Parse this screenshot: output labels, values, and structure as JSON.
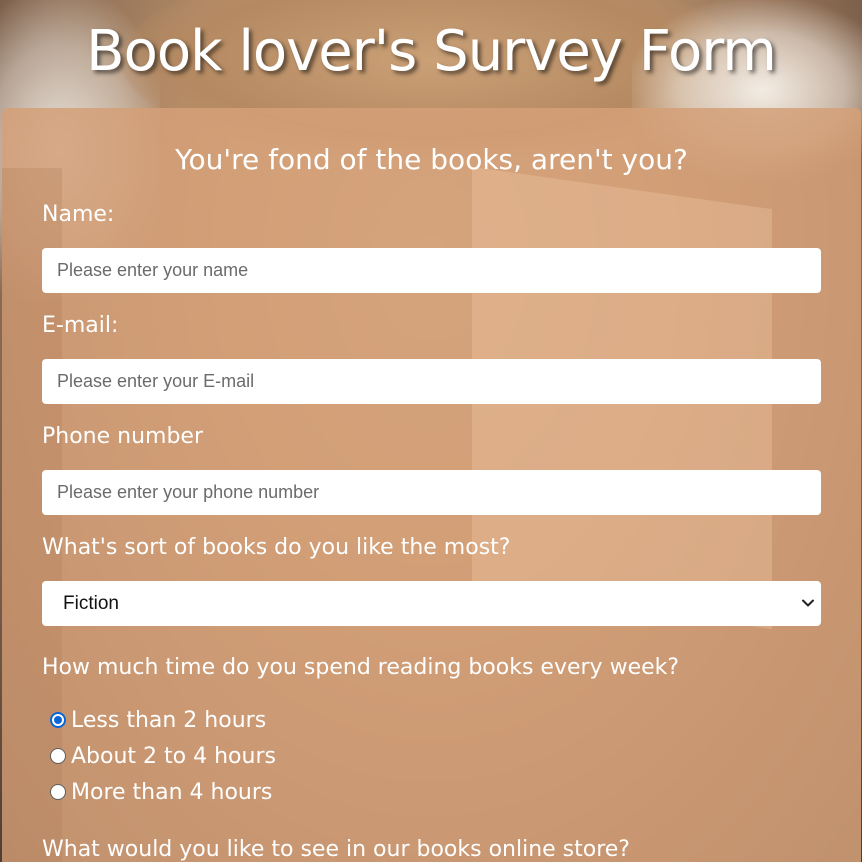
{
  "header": {
    "title": "Book lover's Survey Form"
  },
  "form": {
    "subtitle": "You're fond of the books, aren't you?",
    "name": {
      "label": "Name:",
      "placeholder": "Please enter your name",
      "value": ""
    },
    "email": {
      "label": "E-mail:",
      "placeholder": "Please enter your E-mail",
      "value": ""
    },
    "phone": {
      "label": "Phone number",
      "placeholder": "Please enter your phone number",
      "value": ""
    },
    "book_type": {
      "label": "What's sort of books do you like the most?",
      "selected": "Fiction"
    },
    "reading_time": {
      "label": "How much time do you spend reading books every week?",
      "options": [
        {
          "label": "Less than 2 hours",
          "checked": true
        },
        {
          "label": "About 2 to 4 hours",
          "checked": false
        },
        {
          "label": "More than 4 hours",
          "checked": false
        }
      ]
    },
    "store_question": {
      "label": "What would you like to see in our books online store?"
    }
  },
  "colors": {
    "card_background": "#d4a078",
    "radio_accent": "#0a65d8",
    "text": "#ffffff"
  },
  "icons": {
    "select_arrow": "chevron-down-icon"
  }
}
